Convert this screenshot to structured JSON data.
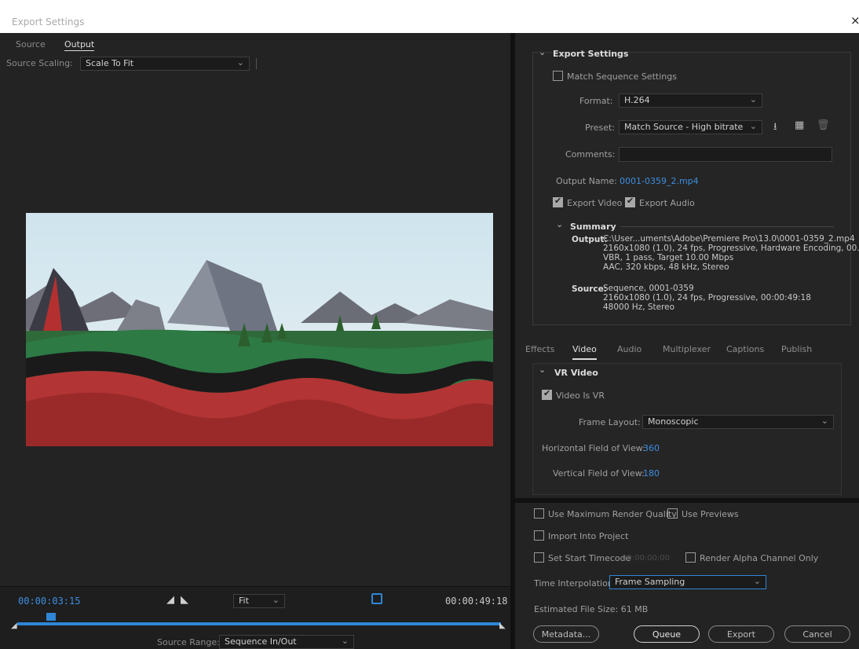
{
  "window": {
    "title": "Export Settings",
    "close_glyph": "×"
  },
  "left": {
    "tabs": [
      "Source",
      "Output"
    ],
    "source_scaling_label": "Source Scaling:",
    "source_scaling_value": "Scale To Fit",
    "time_current": "00:00:03:15",
    "time_end": "00:00:49:18",
    "zoom_value": "Fit",
    "source_range_label": "Source Range:",
    "source_range_value": "Sequence In/Out",
    "playhead_fraction": 0.07
  },
  "export": {
    "header": "Export Settings",
    "match_sequence": "Match Sequence Settings",
    "format_label": "Format:",
    "format_value": "H.264",
    "preset_label": "Preset:",
    "preset_value": "Match Source - High bitrate",
    "comments_label": "Comments:",
    "output_name_label": "Output Name:",
    "output_name_value": "0001-0359_2.mp4",
    "export_video": "Export Video",
    "export_audio": "Export Audio",
    "summary_header": "Summary",
    "output_label": "Output:",
    "output_lines": [
      "C:\\User...uments\\Adobe\\Premiere Pro\\13.0\\0001-0359_2.mp4",
      "2160x1080 (1.0), 24 fps, Progressive, Hardware Encoding, 00...",
      "VBR, 1 pass, Target 10.00 Mbps",
      "AAC, 320 kbps, 48 kHz, Stereo"
    ],
    "source_label": "Source:",
    "source_lines": [
      "Sequence, 0001-0359",
      "2160x1080 (1.0), 24 fps, Progressive, 00:00:49:18",
      "48000 Hz, Stereo"
    ]
  },
  "subtabs": [
    "Effects",
    "Video",
    "Audio",
    "Multiplexer",
    "Captions",
    "Publish"
  ],
  "vr": {
    "header": "VR Video",
    "video_is_vr": "Video Is VR",
    "frame_layout_label": "Frame Layout:",
    "frame_layout_value": "Monoscopic",
    "hfov_label": "Horizontal Field of View:",
    "hfov_value": "360",
    "vfov_label": "Vertical Field of View:",
    "vfov_value": "180"
  },
  "bottom": {
    "max_render": "Use Maximum Render Quality",
    "use_previews": "Use Previews",
    "import_project": "Import Into Project",
    "set_start_tc": "Set Start Timecode",
    "start_tc_value": "00:00:00:00",
    "render_alpha": "Render Alpha Channel Only",
    "time_interp_label": "Time Interpolation:",
    "time_interp_value": "Frame Sampling",
    "file_size": "Estimated File Size:  61 MB",
    "metadata_btn": "Metadata...",
    "queue_btn": "Queue",
    "export_btn": "Export",
    "cancel_btn": "Cancel"
  },
  "colors": {
    "accent": "#3d8ee0",
    "panel": "#232323"
  }
}
